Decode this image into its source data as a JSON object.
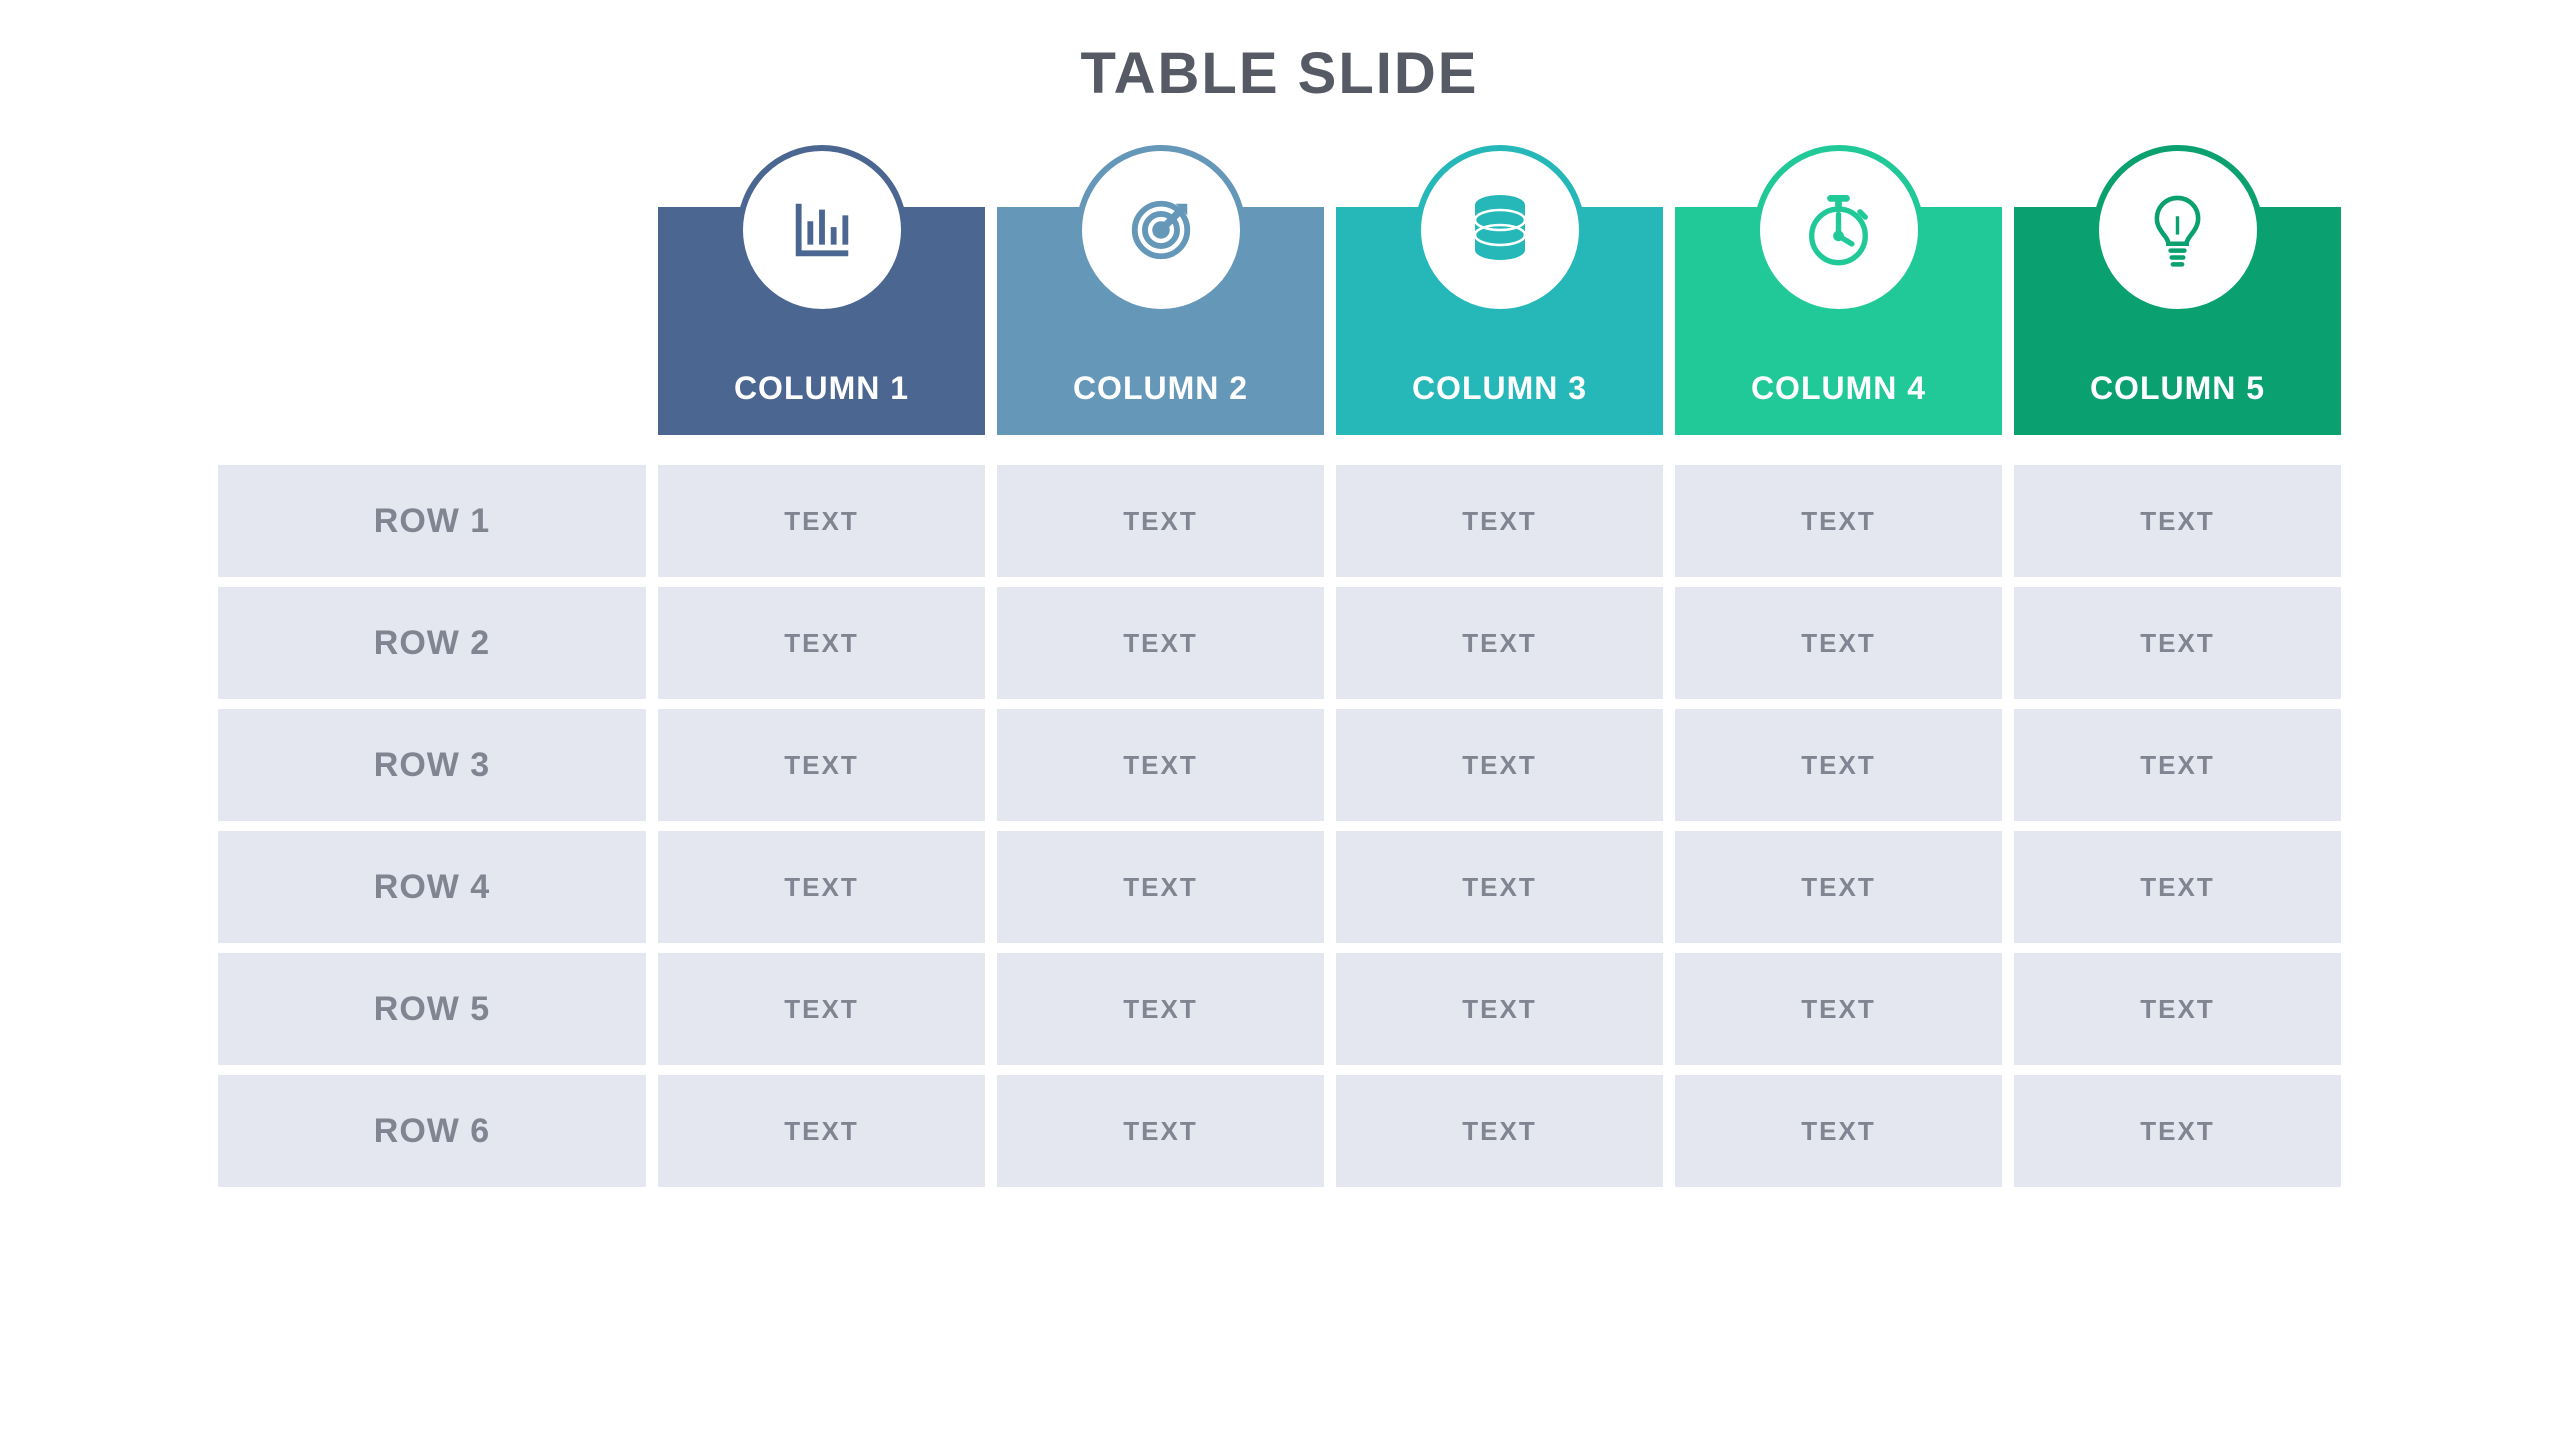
{
  "title": "TABLE SLIDE",
  "columns": [
    {
      "label": "COLUMN 1",
      "icon": "bar-chart-icon",
      "color": "#4b6691"
    },
    {
      "label": "COLUMN 2",
      "icon": "target-icon",
      "color": "#6497b8"
    },
    {
      "label": "COLUMN 3",
      "icon": "database-icon",
      "color": "#26b8b8"
    },
    {
      "label": "COLUMN 4",
      "icon": "stopwatch-icon",
      "color": "#20c997"
    },
    {
      "label": "COLUMN 5",
      "icon": "lightbulb-icon",
      "color": "#0aa06f"
    }
  ],
  "rows": [
    {
      "label": "ROW 1",
      "cells": [
        "TEXT",
        "TEXT",
        "TEXT",
        "TEXT",
        "TEXT"
      ]
    },
    {
      "label": "ROW 2",
      "cells": [
        "TEXT",
        "TEXT",
        "TEXT",
        "TEXT",
        "TEXT"
      ]
    },
    {
      "label": "ROW 3",
      "cells": [
        "TEXT",
        "TEXT",
        "TEXT",
        "TEXT",
        "TEXT"
      ]
    },
    {
      "label": "ROW 4",
      "cells": [
        "TEXT",
        "TEXT",
        "TEXT",
        "TEXT",
        "TEXT"
      ]
    },
    {
      "label": "ROW 5",
      "cells": [
        "TEXT",
        "TEXT",
        "TEXT",
        "TEXT",
        "TEXT"
      ]
    },
    {
      "label": "ROW 6",
      "cells": [
        "TEXT",
        "TEXT",
        "TEXT",
        "TEXT",
        "TEXT"
      ]
    }
  ]
}
